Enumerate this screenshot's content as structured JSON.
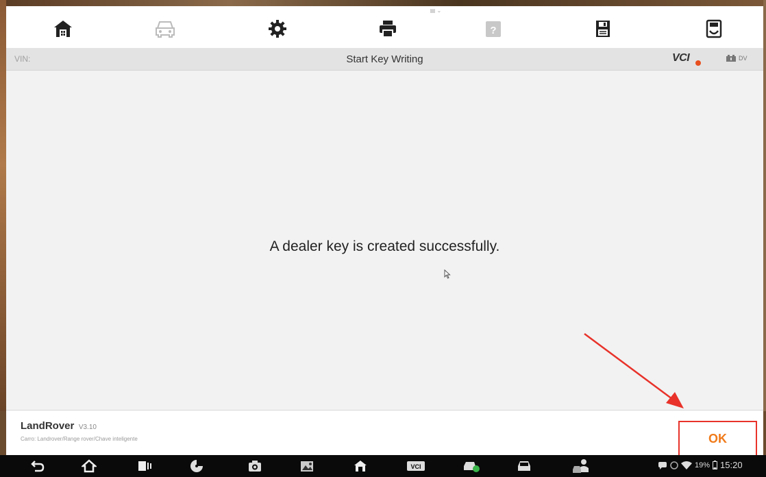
{
  "toolbar": {
    "items": [
      {
        "name": "home-icon",
        "enabled": true
      },
      {
        "name": "vehicle-icon",
        "enabled": false
      },
      {
        "name": "settings-icon",
        "enabled": true
      },
      {
        "name": "print-icon",
        "enabled": true
      },
      {
        "name": "help-icon",
        "enabled": false
      },
      {
        "name": "save-icon",
        "enabled": true
      },
      {
        "name": "data-report-icon",
        "enabled": true
      }
    ]
  },
  "statusbar": {
    "vin_label": "VIN:",
    "title": "Start Key Writing",
    "vci_label": "VCI",
    "dv_label": "DV"
  },
  "content": {
    "message": "A dealer key is created successfully."
  },
  "footer": {
    "brand_name": "LandRover",
    "brand_version": "V3.10",
    "path": "Carro: Landrover/Range rover/Chave inteligente",
    "ok_label": "OK"
  },
  "navbar": {
    "battery": "19%",
    "time": "15:20",
    "items": [
      "back-icon",
      "nav-home-icon",
      "recent-apps-icon",
      "browser-icon",
      "camera-icon",
      "gallery-icon",
      "app-home-icon",
      "vci-app-icon",
      "vehicle-app-icon",
      "car-app-icon",
      "user-vehicle-icon"
    ]
  },
  "colors": {
    "accent_orange": "#f07a1a",
    "highlight_red": "#e8322a",
    "screen_bg": "#f2f2f2"
  }
}
